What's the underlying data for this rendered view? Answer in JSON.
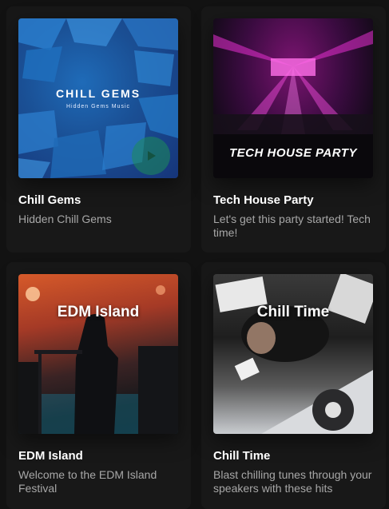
{
  "colors": {
    "background": "#121212",
    "card": "#181818",
    "title": "#ffffff",
    "description": "#a7a7a7",
    "play_button": "#1e8c5a"
  },
  "cards": [
    {
      "title": "Chill Gems",
      "description": "Hidden Chill Gems",
      "art": {
        "title": "CHILL GEMS",
        "subtitle": "Hidden Gems Music"
      },
      "play_icon": "play-icon"
    },
    {
      "title": "Tech House Party",
      "description": "Let's get this party started! Tech time!",
      "art": {
        "title": "TECH HOUSE PARTY"
      }
    },
    {
      "title": "EDM Island",
      "description": "Welcome to the EDM Island Festival",
      "art": {
        "title": "EDM Island"
      }
    },
    {
      "title": "Chill Time",
      "description": "Blast chilling tunes through your speakers with these hits",
      "art": {
        "title": "Chill Time"
      }
    }
  ]
}
